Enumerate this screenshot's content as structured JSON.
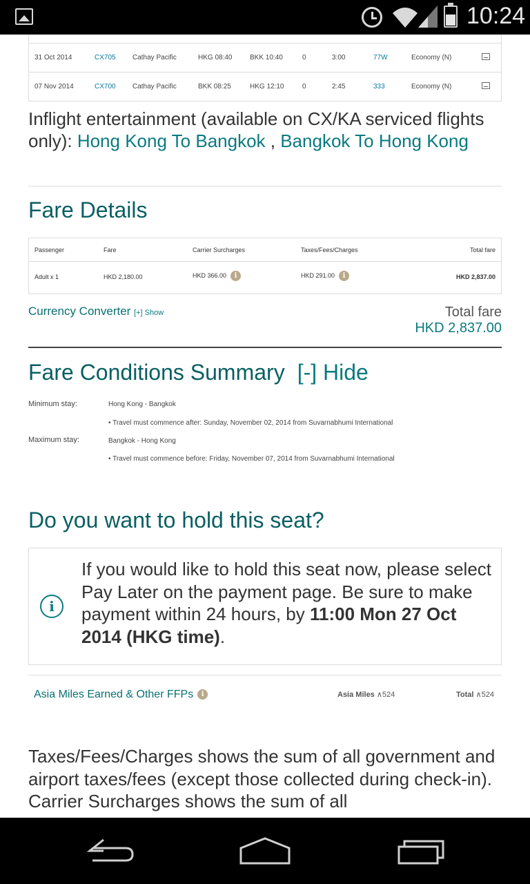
{
  "status_bar": {
    "time": "10:24",
    "icons": [
      "gallery-icon",
      "alarm-icon",
      "wifi-icon",
      "signal-icon",
      "battery-icon"
    ]
  },
  "flights": [
    {
      "date": "31 Oct 2014",
      "flight": "CX705",
      "airline": "Cathay Pacific",
      "depart": "HKG 08:40",
      "arrive": "BKK 10:40",
      "stops": "0",
      "duration": "3:00",
      "aircraft": "77W",
      "cabin": "Economy (N)"
    },
    {
      "date": "07 Nov 2014",
      "flight": "CX700",
      "airline": "Cathay Pacific",
      "depart": "BKK 08:25",
      "arrive": "HKG 12:10",
      "stops": "0",
      "duration": "2:45",
      "aircraft": "333",
      "cabin": "Economy (N)"
    }
  ],
  "ife": {
    "prefix": "Inflight entertainment (available on CX/KA serviced flights only): ",
    "link1": "Hong Kong To Bangkok",
    "sep": " , ",
    "link2": "Bangkok To Hong Kong"
  },
  "fare_details": {
    "title": "Fare Details",
    "headers": {
      "passenger": "Passenger",
      "fare": "Fare",
      "surcharges": "Carrier Surcharges",
      "taxes": "Taxes/Fees/Charges",
      "total": "Total fare"
    },
    "row": {
      "passenger": "Adult x 1",
      "fare": "HKD 2,180.00",
      "surcharges": "HKD 366.00",
      "taxes": "HKD 291.00",
      "total": "HKD 2,837.00"
    },
    "info_glyph": "i"
  },
  "currency_converter": {
    "label": "Currency Converter",
    "toggle": "[+] Show"
  },
  "total_fare": {
    "label": "Total fare",
    "value": "HKD 2,837.00"
  },
  "fare_conditions": {
    "title": "Fare Conditions Summary",
    "toggle": "[-] Hide",
    "min_label": "Minimum stay:",
    "min_route": "Hong Kong - Bangkok",
    "min_note": "• Travel must commence after: Sunday, November 02, 2014 from Suvarnabhumi International",
    "max_label": "Maximum stay:",
    "max_route": "Bangkok - Hong Kong",
    "max_note": "• Travel must commence before: Friday, November 07, 2014 from Suvarnabhumi International"
  },
  "hold": {
    "title": "Do you want to hold this seat?",
    "info_glyph": "i",
    "text": "If you would like to hold this seat now, please select Pay Later on the payment page. Be sure to make payment within 24 hours, by ",
    "deadline": "11:00 Mon 27 Oct 2014 (HKG time)",
    "end": "."
  },
  "miles": {
    "label": "Asia Miles Earned & Other FFPs",
    "info_glyph": "i",
    "asia_label": "Asia Miles",
    "asia_value": "∧524",
    "total_label": "Total",
    "total_value": "∧524"
  },
  "description": "Taxes/Fees/Charges shows the sum of all government and airport taxes/fees (except those collected during check-in). Carrier Surcharges shows the sum of all",
  "nav_bar": {
    "icons": [
      "back-icon",
      "home-icon",
      "recents-icon"
    ]
  }
}
